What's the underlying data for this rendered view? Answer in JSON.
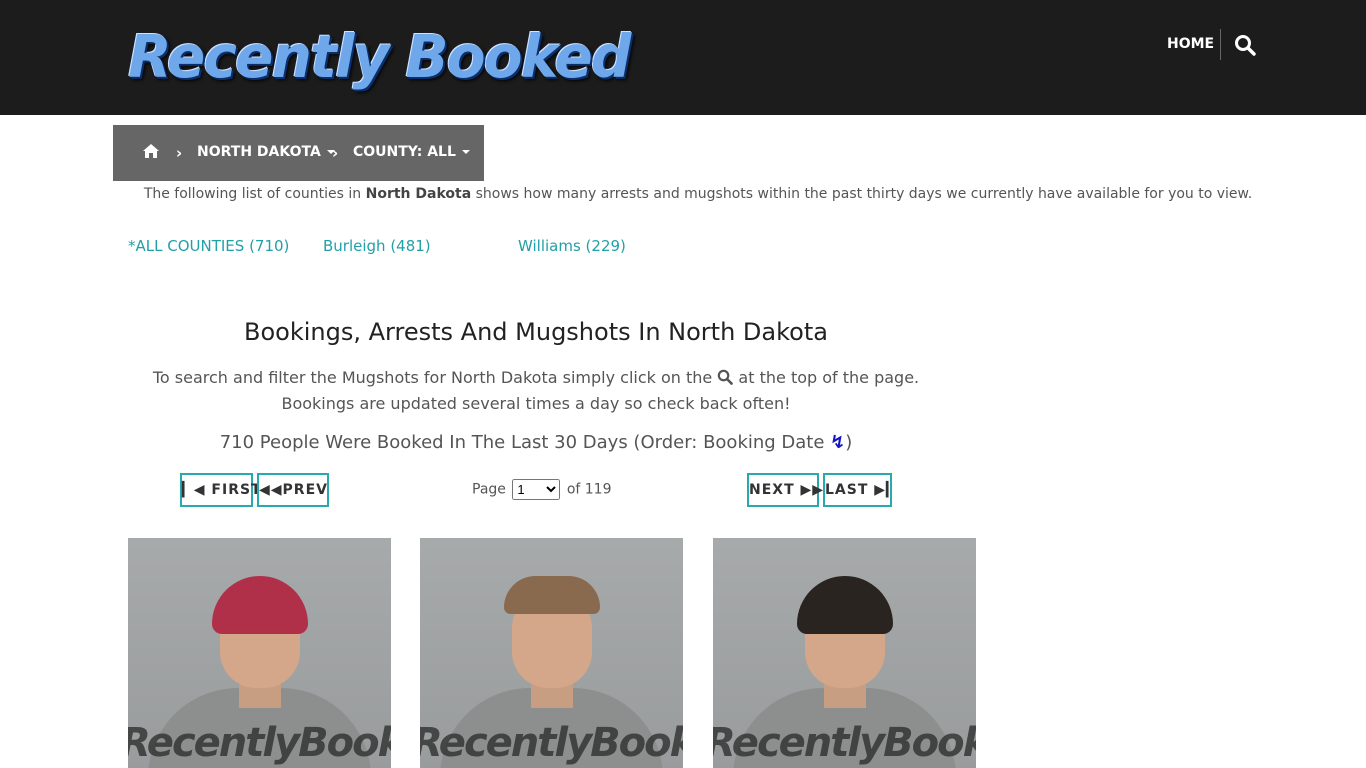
{
  "site": {
    "logo_text": "Recently Booked",
    "nav_home": "HOME",
    "search_icon": "search-icon"
  },
  "breadcrumb": {
    "home_icon": "home-icon",
    "state": "NORTH DAKOTA",
    "county": "COUNTY: ALL"
  },
  "intro": {
    "before": "The following list of counties in ",
    "state": "North Dakota",
    "after": " shows how many arrests and mugshots within the past thirty days we currently have available for you to view."
  },
  "counties": [
    "*ALL COUNTIES (710)",
    "Burleigh (481)",
    "Williams (229)"
  ],
  "heading": "Bookings, Arrests And Mugshots In North Dakota",
  "description": {
    "before": "To search and filter the Mugshots for North Dakota simply click on the ",
    "after": " at the top of the page. Bookings are updated several times a day so check back often!"
  },
  "count_line": {
    "text": "710 People Were Booked In The Last 30 Days (Order: Booking Date ",
    "close": ")"
  },
  "pagination": {
    "first": "FIRST",
    "prev": "PREV",
    "next": "NEXT",
    "last": "LAST",
    "page_label": "Page",
    "current_page": "1",
    "of_label": "of 119"
  },
  "mugshots": [
    {
      "watermark": "RecentlyBooked.com",
      "hair_color": "#b0304a"
    },
    {
      "watermark": "RecentlyBooked.com",
      "hair_color": "#8a6a4e"
    },
    {
      "watermark": "RecentlyBooked.com",
      "hair_color": "#2a2420"
    }
  ]
}
